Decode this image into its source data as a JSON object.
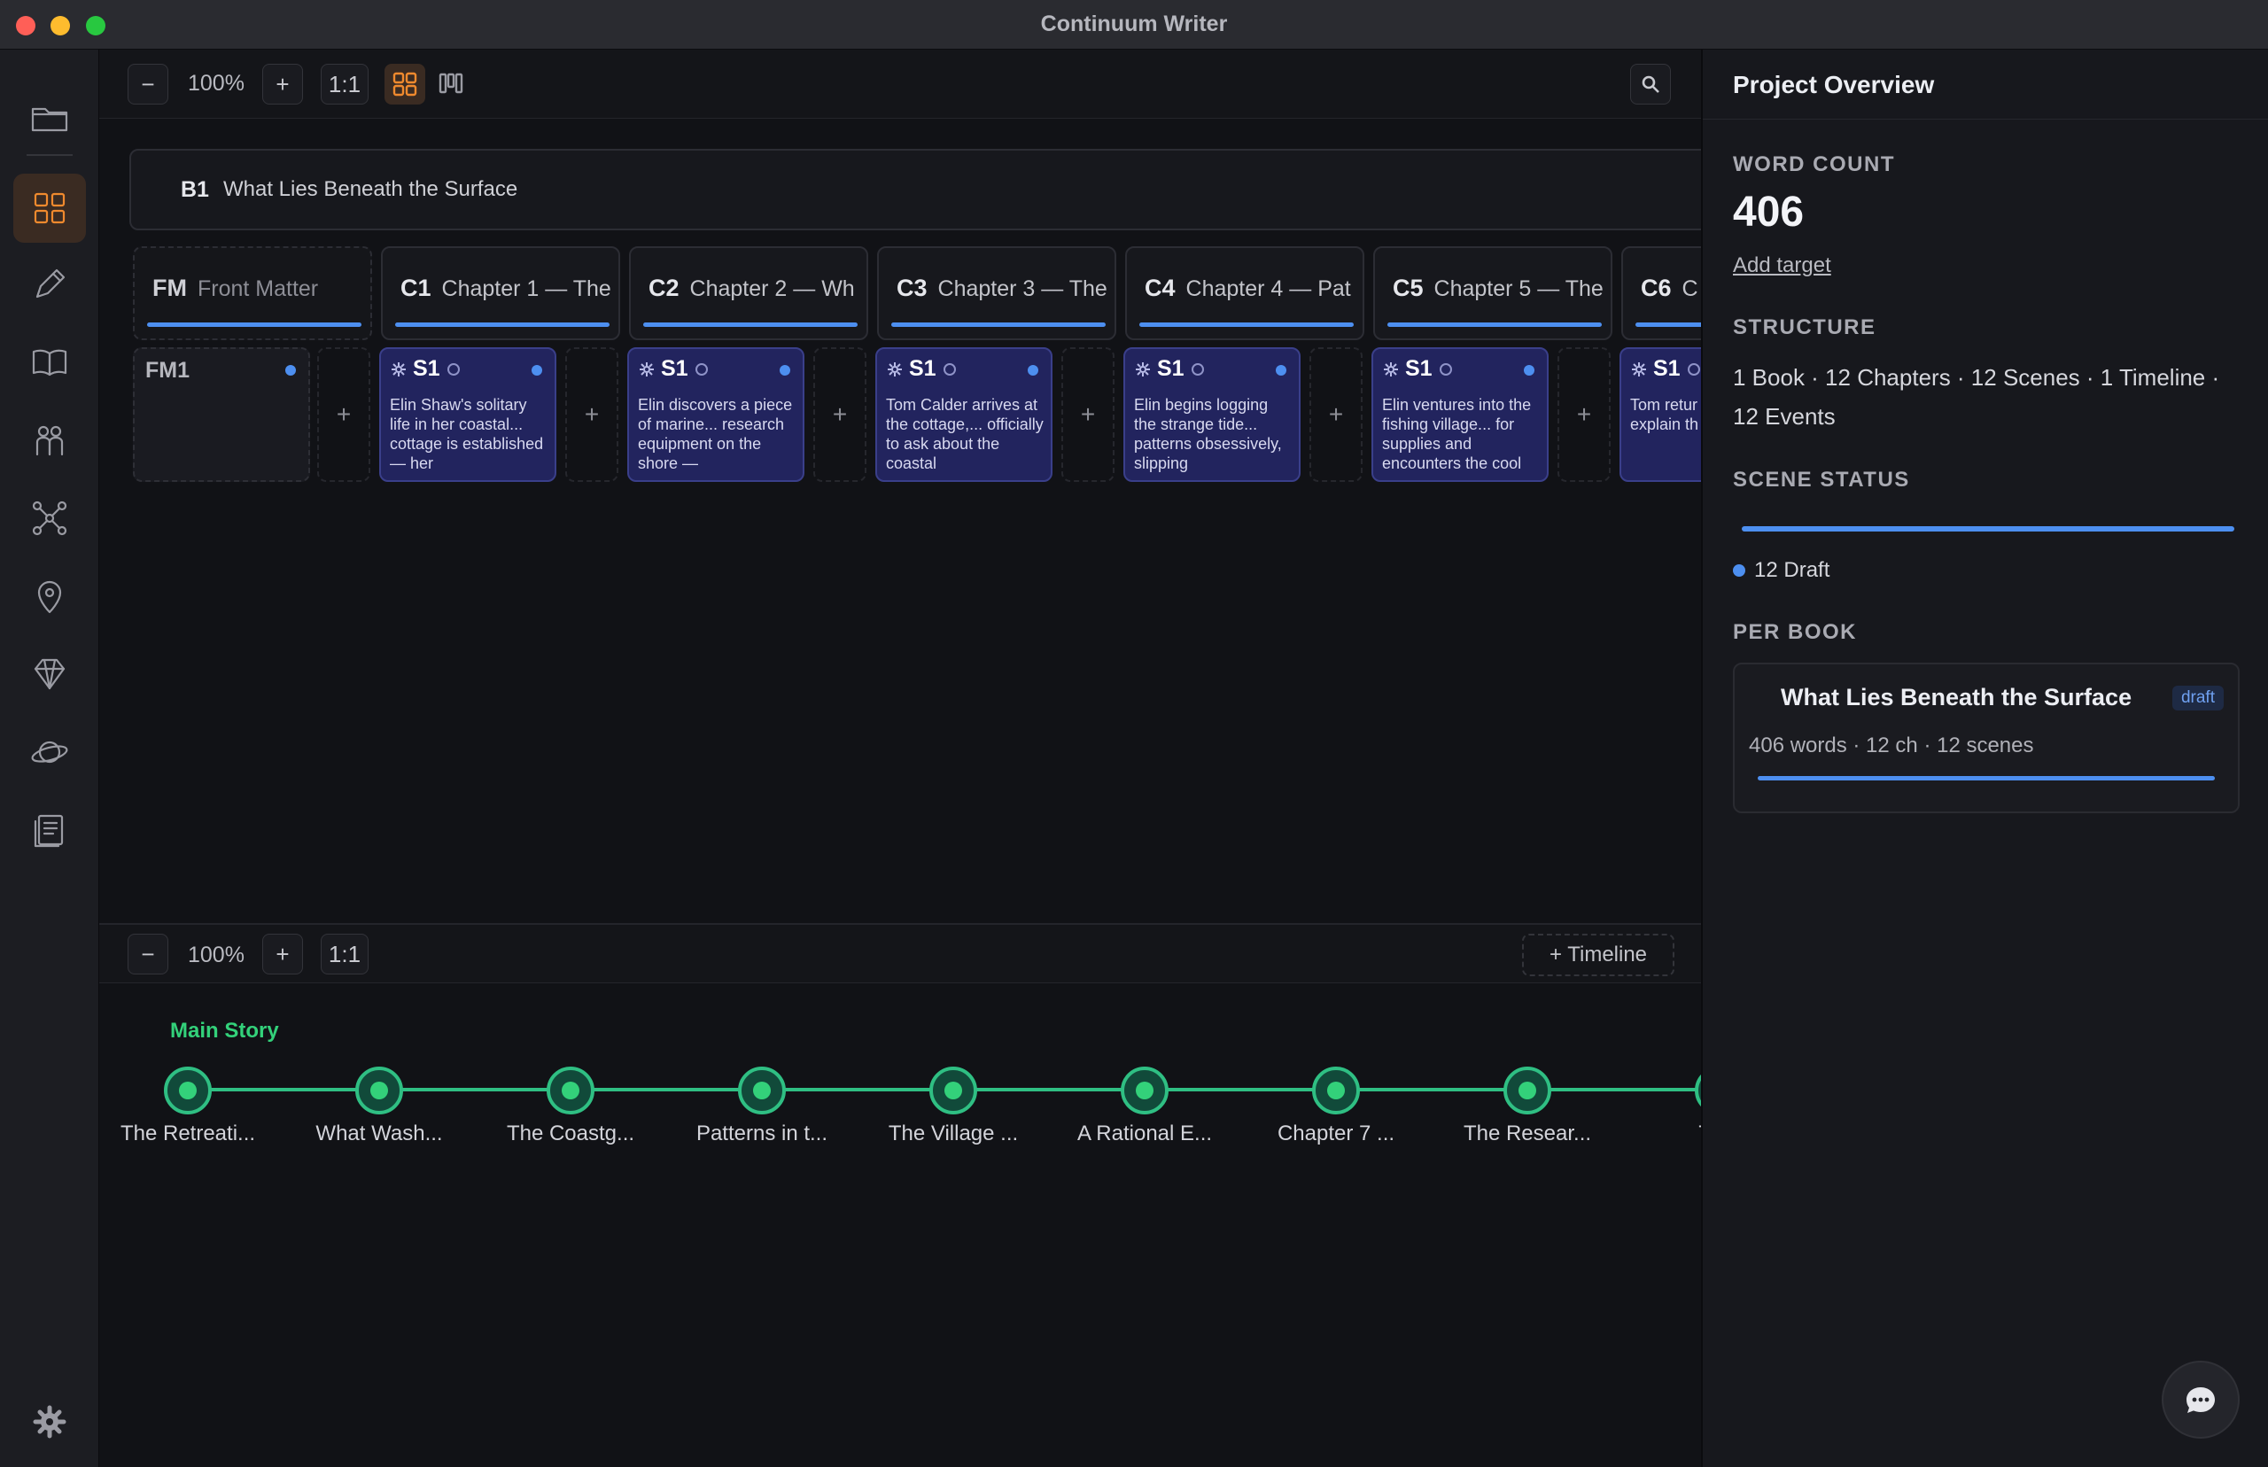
{
  "window": {
    "title": "Continuum Writer"
  },
  "toolbar": {
    "zoom_out": "−",
    "zoom": "100%",
    "zoom_in": "+",
    "reset": "1:1"
  },
  "book": {
    "code": "B1",
    "title": "What Lies Beneath the Surface"
  },
  "columns": [
    {
      "code": "FM",
      "title": "Front Matter"
    },
    {
      "code": "C1",
      "title": "Chapter 1 — The"
    },
    {
      "code": "C2",
      "title": "Chapter 2 — Wh"
    },
    {
      "code": "C3",
      "title": "Chapter 3 — The"
    },
    {
      "code": "C4",
      "title": "Chapter 4 — Pat"
    },
    {
      "code": "C5",
      "title": "Chapter 5 — The"
    },
    {
      "code": "C6",
      "title": "C"
    }
  ],
  "front_matter_card": {
    "label": "FM1"
  },
  "add_label": "+",
  "scenes": [
    {
      "code": "S1",
      "text": "Elin Shaw's solitary life in her coastal... cottage is established — her"
    },
    {
      "code": "S1",
      "text": "Elin discovers a piece of marine... research equipment on the shore —"
    },
    {
      "code": "S1",
      "text": "Tom Calder arrives at the cottage,... officially to ask about the coastal"
    },
    {
      "code": "S1",
      "text": "Elin begins logging the strange tide... patterns obsessively, slipping"
    },
    {
      "code": "S1",
      "text": "Elin ventures into the fishing village... for supplies and encounters the cool"
    },
    {
      "code": "S1",
      "text": "Tom retur official fir explain th up equipr"
    }
  ],
  "timeline_toolbar": {
    "zoom_out": "−",
    "zoom": "100%",
    "zoom_in": "+",
    "reset": "1:1",
    "add_timeline": "+ Timeline"
  },
  "timeline": {
    "lane": "Main Story",
    "events": [
      "The Retreati...",
      "What Wash...",
      "The Coastg...",
      "Patterns in t...",
      "The Village ...",
      "A Rational E...",
      "Chapter 7 ...",
      "The Resear...",
      "Tom"
    ]
  },
  "panel": {
    "title": "Project Overview",
    "word_count_label": "WORD COUNT",
    "word_count": "406",
    "add_target": "Add target",
    "structure_label": "STRUCTURE",
    "structure": "1 Book · 12 Chapters · 12 Scenes · 1 Timeline · 12 Events",
    "scene_status_label": "SCENE STATUS",
    "draft_legend": "12 Draft",
    "per_book_label": "PER BOOK",
    "book_card": {
      "title": "What Lies Beneath the Surface",
      "badge": "draft",
      "meta": "406 words · 12 ch · 12 scenes"
    }
  },
  "colors": {
    "accent": "#f08a2e",
    "blue": "#4d8ff0",
    "green": "#33d17a",
    "scene_card": "#22245e"
  }
}
